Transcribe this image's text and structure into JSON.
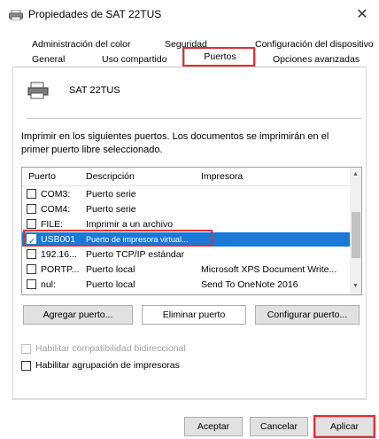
{
  "window": {
    "title": "Propiedades de SAT 22TUS",
    "close_symbol": "✕"
  },
  "tabs": {
    "row1": [
      "Administración del color",
      "Seguridad",
      "Configuración del dispositivo"
    ],
    "row2": [
      "General",
      "Uso compartido",
      "Puertos",
      "Opciones avanzadas"
    ],
    "active": "Puertos"
  },
  "printer": {
    "name": "SAT 22TUS",
    "icon": "printer-icon"
  },
  "instructions": "Imprimir en los siguientes puertos. Los documentos se imprimirán en el primer puerto libre seleccionado.",
  "ports_table": {
    "headers": {
      "port": "Puerto",
      "description": "Descripción",
      "printer": "Impresora"
    },
    "rows": [
      {
        "port": "COM3:",
        "description": "Puerto serie",
        "printer": "",
        "checked": false
      },
      {
        "port": "COM4:",
        "description": "Puerto serie",
        "printer": "",
        "checked": false
      },
      {
        "port": "FILE:",
        "description": "Imprimir a un archivo",
        "printer": "",
        "checked": false
      },
      {
        "port": "USB001",
        "description": "Puerto de impresora virtual...",
        "printer": "",
        "checked": true,
        "selected": true
      },
      {
        "port": "192.16...",
        "description": "Puerto TCP/IP estándar",
        "printer": "",
        "checked": false
      },
      {
        "port": "PORTP...",
        "description": "Puerto local",
        "printer": "Microsoft XPS Document Write...",
        "checked": false
      },
      {
        "port": "nul:",
        "description": "Puerto local",
        "printer": "Send To OneNote 2016",
        "checked": false
      }
    ],
    "scroll_up": "▲",
    "scroll_down": "▼"
  },
  "port_buttons": {
    "add": "Agregar puerto...",
    "delete": "Eliminar puerto",
    "configure": "Configurar puerto..."
  },
  "options": {
    "bidirectional": {
      "label": "Habilitar compatibilidad bidireccional",
      "enabled": false,
      "checked": false
    },
    "pooling": {
      "label": "Habilitar agrupación de impresoras",
      "enabled": true,
      "checked": false
    }
  },
  "dialog_buttons": {
    "accept": "Aceptar",
    "cancel": "Cancelar",
    "apply": "Aplicar"
  },
  "colors": {
    "selection": "#1a78d6",
    "highlight_border": "#e03030"
  }
}
